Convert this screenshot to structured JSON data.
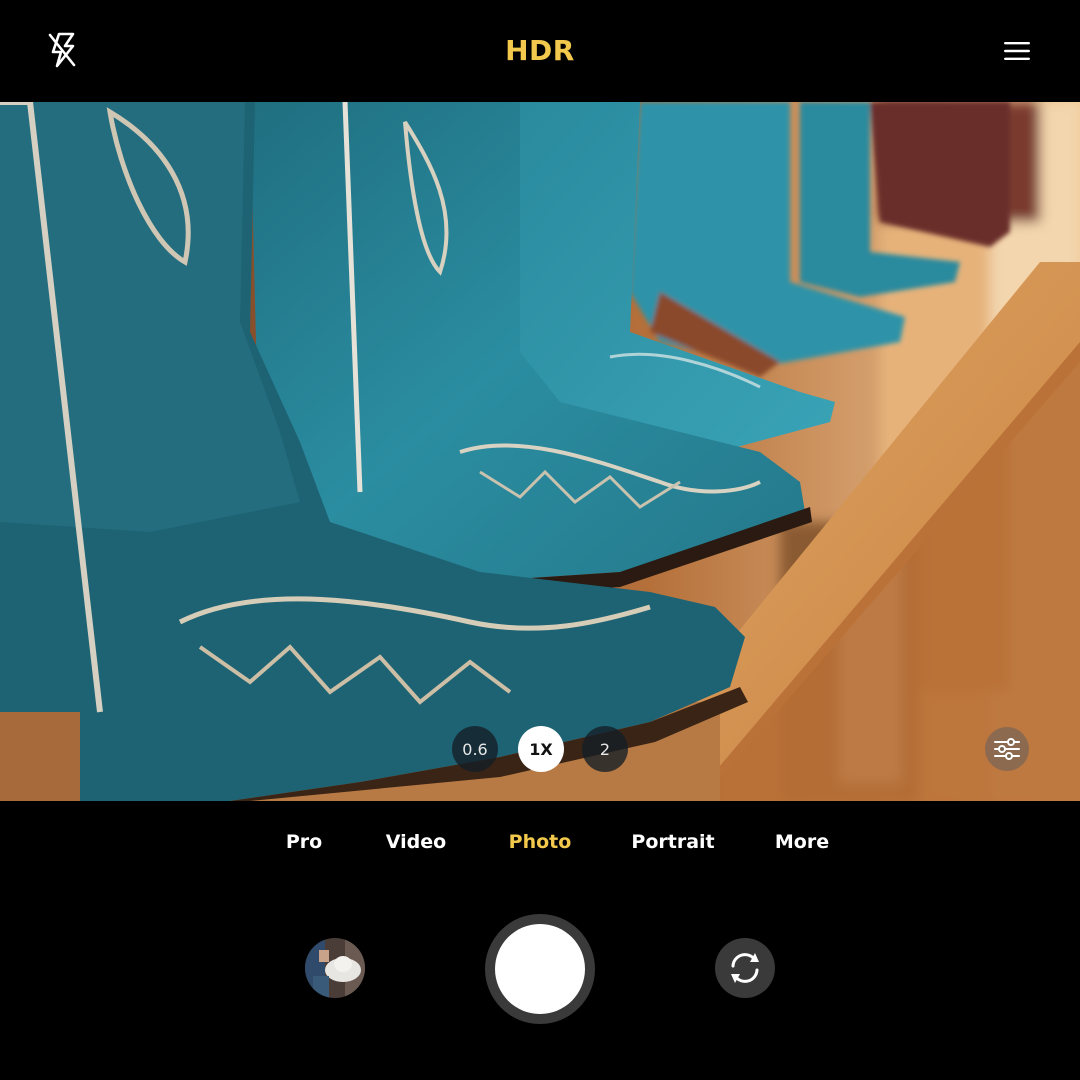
{
  "colors": {
    "accent": "#f2c94c",
    "background": "#000000",
    "text": "#ffffff",
    "boot": "#2a8a9e",
    "shelf": "#d7954f"
  },
  "topbar": {
    "flash_icon": "flash-off-icon",
    "hdr_label": "HDR",
    "menu_icon": "hamburger-menu-icon"
  },
  "viewfinder": {
    "subject": "photo",
    "zoom_options": [
      "0.6",
      "1X",
      "2"
    ],
    "active_zoom": "1X",
    "settings_icon": "sliders-icon"
  },
  "modes": {
    "items": [
      "Pro",
      "Video",
      "Photo",
      "Portrait",
      "More"
    ],
    "active": "Photo"
  },
  "controls": {
    "gallery_icon": "gallery-thumbnail",
    "shutter_icon": "shutter-button",
    "flip_icon": "camera-flip-icon"
  }
}
